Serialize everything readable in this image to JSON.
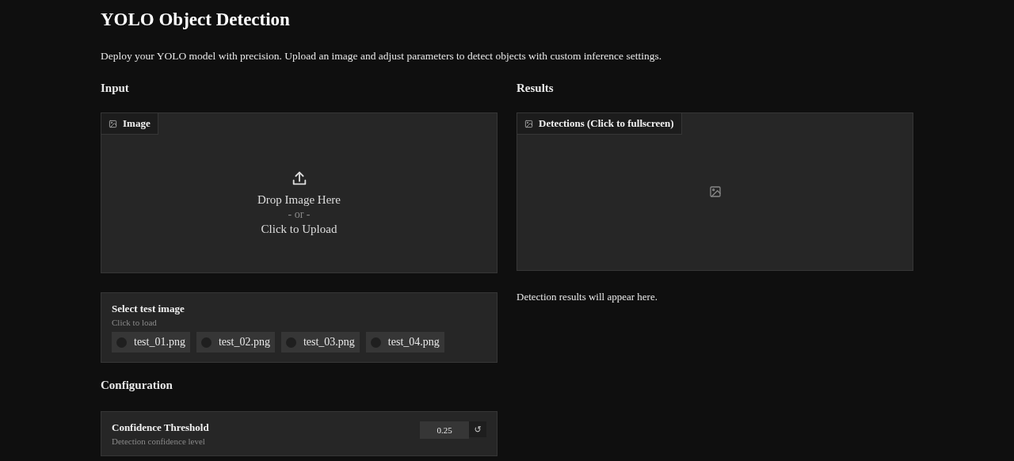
{
  "title": "YOLO Object Detection",
  "description": "Deploy your YOLO model with precision. Upload an image and adjust parameters to detect objects with custom inference settings.",
  "input": {
    "heading": "Input",
    "image_label": "Image",
    "drop_text": "Drop Image Here",
    "or_text": "- or -",
    "click_text": "Click to Upload"
  },
  "examples": {
    "title": "Select test image",
    "hint": "Click to load",
    "items": [
      {
        "label": "test_01.png",
        "selected": false
      },
      {
        "label": "test_02.png",
        "selected": false
      },
      {
        "label": "test_03.png",
        "selected": false
      },
      {
        "label": "test_04.png",
        "selected": false
      }
    ]
  },
  "configuration": {
    "heading": "Configuration",
    "sliders": [
      {
        "label": "Confidence Threshold",
        "hint": "Detection confidence level",
        "value": "0.25",
        "reset": "↺"
      }
    ]
  },
  "results": {
    "heading": "Results",
    "image_label": "Detections (Click to fullscreen)",
    "message": "Detection results will appear here."
  }
}
